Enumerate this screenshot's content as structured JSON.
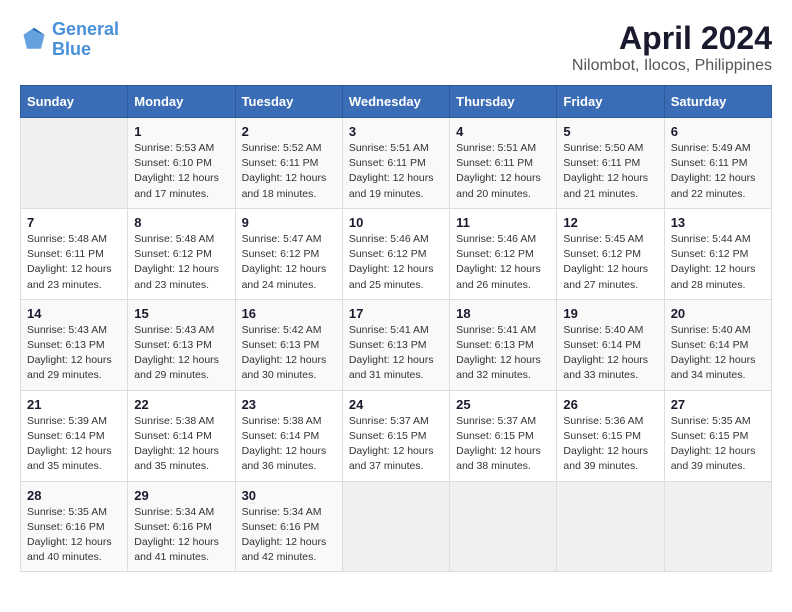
{
  "header": {
    "logo_line1": "General",
    "logo_line2": "Blue",
    "title": "April 2024",
    "subtitle": "Nilombot, Ilocos, Philippines"
  },
  "columns": [
    "Sunday",
    "Monday",
    "Tuesday",
    "Wednesday",
    "Thursday",
    "Friday",
    "Saturday"
  ],
  "weeks": [
    [
      {
        "day": "",
        "info": ""
      },
      {
        "day": "1",
        "info": "Sunrise: 5:53 AM\nSunset: 6:10 PM\nDaylight: 12 hours\nand 17 minutes."
      },
      {
        "day": "2",
        "info": "Sunrise: 5:52 AM\nSunset: 6:11 PM\nDaylight: 12 hours\nand 18 minutes."
      },
      {
        "day": "3",
        "info": "Sunrise: 5:51 AM\nSunset: 6:11 PM\nDaylight: 12 hours\nand 19 minutes."
      },
      {
        "day": "4",
        "info": "Sunrise: 5:51 AM\nSunset: 6:11 PM\nDaylight: 12 hours\nand 20 minutes."
      },
      {
        "day": "5",
        "info": "Sunrise: 5:50 AM\nSunset: 6:11 PM\nDaylight: 12 hours\nand 21 minutes."
      },
      {
        "day": "6",
        "info": "Sunrise: 5:49 AM\nSunset: 6:11 PM\nDaylight: 12 hours\nand 22 minutes."
      }
    ],
    [
      {
        "day": "7",
        "info": "Sunrise: 5:48 AM\nSunset: 6:11 PM\nDaylight: 12 hours\nand 23 minutes."
      },
      {
        "day": "8",
        "info": "Sunrise: 5:48 AM\nSunset: 6:12 PM\nDaylight: 12 hours\nand 23 minutes."
      },
      {
        "day": "9",
        "info": "Sunrise: 5:47 AM\nSunset: 6:12 PM\nDaylight: 12 hours\nand 24 minutes."
      },
      {
        "day": "10",
        "info": "Sunrise: 5:46 AM\nSunset: 6:12 PM\nDaylight: 12 hours\nand 25 minutes."
      },
      {
        "day": "11",
        "info": "Sunrise: 5:46 AM\nSunset: 6:12 PM\nDaylight: 12 hours\nand 26 minutes."
      },
      {
        "day": "12",
        "info": "Sunrise: 5:45 AM\nSunset: 6:12 PM\nDaylight: 12 hours\nand 27 minutes."
      },
      {
        "day": "13",
        "info": "Sunrise: 5:44 AM\nSunset: 6:12 PM\nDaylight: 12 hours\nand 28 minutes."
      }
    ],
    [
      {
        "day": "14",
        "info": "Sunrise: 5:43 AM\nSunset: 6:13 PM\nDaylight: 12 hours\nand 29 minutes."
      },
      {
        "day": "15",
        "info": "Sunrise: 5:43 AM\nSunset: 6:13 PM\nDaylight: 12 hours\nand 29 minutes."
      },
      {
        "day": "16",
        "info": "Sunrise: 5:42 AM\nSunset: 6:13 PM\nDaylight: 12 hours\nand 30 minutes."
      },
      {
        "day": "17",
        "info": "Sunrise: 5:41 AM\nSunset: 6:13 PM\nDaylight: 12 hours\nand 31 minutes."
      },
      {
        "day": "18",
        "info": "Sunrise: 5:41 AM\nSunset: 6:13 PM\nDaylight: 12 hours\nand 32 minutes."
      },
      {
        "day": "19",
        "info": "Sunrise: 5:40 AM\nSunset: 6:14 PM\nDaylight: 12 hours\nand 33 minutes."
      },
      {
        "day": "20",
        "info": "Sunrise: 5:40 AM\nSunset: 6:14 PM\nDaylight: 12 hours\nand 34 minutes."
      }
    ],
    [
      {
        "day": "21",
        "info": "Sunrise: 5:39 AM\nSunset: 6:14 PM\nDaylight: 12 hours\nand 35 minutes."
      },
      {
        "day": "22",
        "info": "Sunrise: 5:38 AM\nSunset: 6:14 PM\nDaylight: 12 hours\nand 35 minutes."
      },
      {
        "day": "23",
        "info": "Sunrise: 5:38 AM\nSunset: 6:14 PM\nDaylight: 12 hours\nand 36 minutes."
      },
      {
        "day": "24",
        "info": "Sunrise: 5:37 AM\nSunset: 6:15 PM\nDaylight: 12 hours\nand 37 minutes."
      },
      {
        "day": "25",
        "info": "Sunrise: 5:37 AM\nSunset: 6:15 PM\nDaylight: 12 hours\nand 38 minutes."
      },
      {
        "day": "26",
        "info": "Sunrise: 5:36 AM\nSunset: 6:15 PM\nDaylight: 12 hours\nand 39 minutes."
      },
      {
        "day": "27",
        "info": "Sunrise: 5:35 AM\nSunset: 6:15 PM\nDaylight: 12 hours\nand 39 minutes."
      }
    ],
    [
      {
        "day": "28",
        "info": "Sunrise: 5:35 AM\nSunset: 6:16 PM\nDaylight: 12 hours\nand 40 minutes."
      },
      {
        "day": "29",
        "info": "Sunrise: 5:34 AM\nSunset: 6:16 PM\nDaylight: 12 hours\nand 41 minutes."
      },
      {
        "day": "30",
        "info": "Sunrise: 5:34 AM\nSunset: 6:16 PM\nDaylight: 12 hours\nand 42 minutes."
      },
      {
        "day": "",
        "info": ""
      },
      {
        "day": "",
        "info": ""
      },
      {
        "day": "",
        "info": ""
      },
      {
        "day": "",
        "info": ""
      }
    ]
  ]
}
